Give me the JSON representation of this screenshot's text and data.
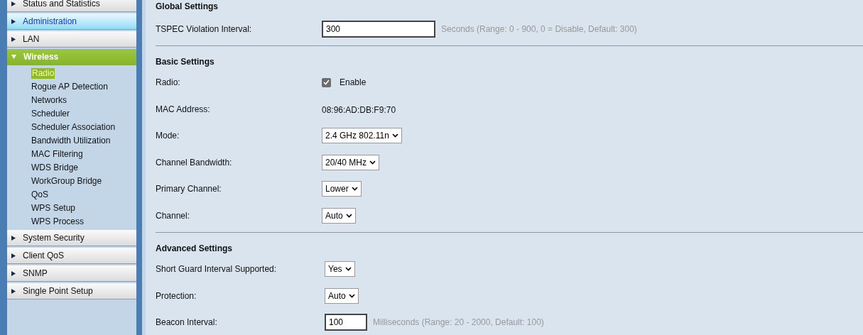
{
  "nav": [
    {
      "label": "Status and Statistics",
      "expanded": false,
      "hovered": false
    },
    {
      "label": "Administration",
      "expanded": false,
      "hovered": true
    },
    {
      "label": "LAN",
      "expanded": false,
      "hovered": false
    },
    {
      "label": "Wireless",
      "expanded": true,
      "hovered": false,
      "children": [
        {
          "label": "Radio",
          "selected": true
        },
        {
          "label": "Rogue AP Detection",
          "selected": false
        },
        {
          "label": "Networks",
          "selected": false
        },
        {
          "label": "Scheduler",
          "selected": false
        },
        {
          "label": "Scheduler Association",
          "selected": false
        },
        {
          "label": "Bandwidth Utilization",
          "selected": false
        },
        {
          "label": "MAC Filtering",
          "selected": false
        },
        {
          "label": "WDS Bridge",
          "selected": false
        },
        {
          "label": "WorkGroup Bridge",
          "selected": false
        },
        {
          "label": "QoS",
          "selected": false
        },
        {
          "label": "WPS Setup",
          "selected": false
        },
        {
          "label": "WPS Process",
          "selected": false
        }
      ]
    },
    {
      "label": "System Security",
      "expanded": false,
      "hovered": false
    },
    {
      "label": "Client QoS",
      "expanded": false,
      "hovered": false
    },
    {
      "label": "SNMP",
      "expanded": false,
      "hovered": false
    },
    {
      "label": "Single Point Setup",
      "expanded": false,
      "hovered": false
    }
  ],
  "sections": [
    {
      "title": "Global Settings",
      "rows": [
        {
          "kind": "input",
          "label": "TSPEC Violation Interval:",
          "value": "300",
          "hint": "Seconds (Range: 0 - 900, 0 = Disable, Default: 300)"
        }
      ]
    },
    {
      "title": "Basic Settings",
      "rows": [
        {
          "kind": "checkbox",
          "label": "Radio:",
          "checked": true,
          "text": "Enable"
        },
        {
          "kind": "text",
          "label": "MAC Address:",
          "value": "08:96:AD:DB:F9:70"
        },
        {
          "kind": "select",
          "label": "Mode:",
          "value": "2.4 GHz 802.11n"
        },
        {
          "kind": "select",
          "label": "Channel Bandwidth:",
          "value": "20/40 MHz"
        },
        {
          "kind": "select",
          "label": "Primary Channel:",
          "value": "Lower"
        },
        {
          "kind": "select",
          "label": "Channel:",
          "value": "Auto"
        }
      ]
    },
    {
      "title": "Advanced Settings",
      "rows": [
        {
          "kind": "select",
          "label": "Short Guard Interval Supported:",
          "value": "Yes"
        },
        {
          "kind": "select",
          "label": "Protection:",
          "value": "Auto"
        },
        {
          "kind": "input",
          "label": "Beacon Interval:",
          "value": "100",
          "hint": "Milliseconds (Range: 20 - 2000, Default: 100)"
        }
      ]
    }
  ]
}
